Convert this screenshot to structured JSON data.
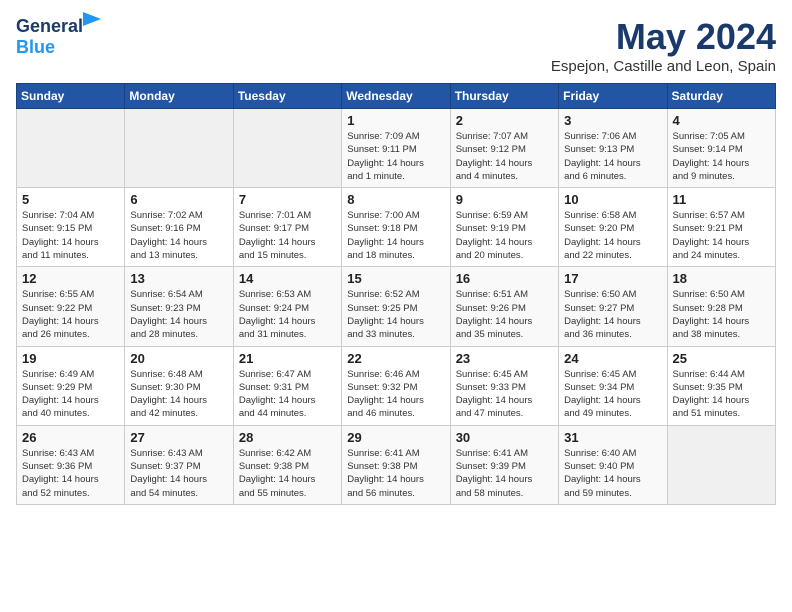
{
  "header": {
    "logo_line1": "General",
    "logo_line2": "Blue",
    "month": "May 2024",
    "location": "Espejon, Castille and Leon, Spain"
  },
  "weekdays": [
    "Sunday",
    "Monday",
    "Tuesday",
    "Wednesday",
    "Thursday",
    "Friday",
    "Saturday"
  ],
  "weeks": [
    [
      {
        "day": "",
        "info": ""
      },
      {
        "day": "",
        "info": ""
      },
      {
        "day": "",
        "info": ""
      },
      {
        "day": "1",
        "info": "Sunrise: 7:09 AM\nSunset: 9:11 PM\nDaylight: 14 hours\nand 1 minute."
      },
      {
        "day": "2",
        "info": "Sunrise: 7:07 AM\nSunset: 9:12 PM\nDaylight: 14 hours\nand 4 minutes."
      },
      {
        "day": "3",
        "info": "Sunrise: 7:06 AM\nSunset: 9:13 PM\nDaylight: 14 hours\nand 6 minutes."
      },
      {
        "day": "4",
        "info": "Sunrise: 7:05 AM\nSunset: 9:14 PM\nDaylight: 14 hours\nand 9 minutes."
      }
    ],
    [
      {
        "day": "5",
        "info": "Sunrise: 7:04 AM\nSunset: 9:15 PM\nDaylight: 14 hours\nand 11 minutes."
      },
      {
        "day": "6",
        "info": "Sunrise: 7:02 AM\nSunset: 9:16 PM\nDaylight: 14 hours\nand 13 minutes."
      },
      {
        "day": "7",
        "info": "Sunrise: 7:01 AM\nSunset: 9:17 PM\nDaylight: 14 hours\nand 15 minutes."
      },
      {
        "day": "8",
        "info": "Sunrise: 7:00 AM\nSunset: 9:18 PM\nDaylight: 14 hours\nand 18 minutes."
      },
      {
        "day": "9",
        "info": "Sunrise: 6:59 AM\nSunset: 9:19 PM\nDaylight: 14 hours\nand 20 minutes."
      },
      {
        "day": "10",
        "info": "Sunrise: 6:58 AM\nSunset: 9:20 PM\nDaylight: 14 hours\nand 22 minutes."
      },
      {
        "day": "11",
        "info": "Sunrise: 6:57 AM\nSunset: 9:21 PM\nDaylight: 14 hours\nand 24 minutes."
      }
    ],
    [
      {
        "day": "12",
        "info": "Sunrise: 6:55 AM\nSunset: 9:22 PM\nDaylight: 14 hours\nand 26 minutes."
      },
      {
        "day": "13",
        "info": "Sunrise: 6:54 AM\nSunset: 9:23 PM\nDaylight: 14 hours\nand 28 minutes."
      },
      {
        "day": "14",
        "info": "Sunrise: 6:53 AM\nSunset: 9:24 PM\nDaylight: 14 hours\nand 31 minutes."
      },
      {
        "day": "15",
        "info": "Sunrise: 6:52 AM\nSunset: 9:25 PM\nDaylight: 14 hours\nand 33 minutes."
      },
      {
        "day": "16",
        "info": "Sunrise: 6:51 AM\nSunset: 9:26 PM\nDaylight: 14 hours\nand 35 minutes."
      },
      {
        "day": "17",
        "info": "Sunrise: 6:50 AM\nSunset: 9:27 PM\nDaylight: 14 hours\nand 36 minutes."
      },
      {
        "day": "18",
        "info": "Sunrise: 6:50 AM\nSunset: 9:28 PM\nDaylight: 14 hours\nand 38 minutes."
      }
    ],
    [
      {
        "day": "19",
        "info": "Sunrise: 6:49 AM\nSunset: 9:29 PM\nDaylight: 14 hours\nand 40 minutes."
      },
      {
        "day": "20",
        "info": "Sunrise: 6:48 AM\nSunset: 9:30 PM\nDaylight: 14 hours\nand 42 minutes."
      },
      {
        "day": "21",
        "info": "Sunrise: 6:47 AM\nSunset: 9:31 PM\nDaylight: 14 hours\nand 44 minutes."
      },
      {
        "day": "22",
        "info": "Sunrise: 6:46 AM\nSunset: 9:32 PM\nDaylight: 14 hours\nand 46 minutes."
      },
      {
        "day": "23",
        "info": "Sunrise: 6:45 AM\nSunset: 9:33 PM\nDaylight: 14 hours\nand 47 minutes."
      },
      {
        "day": "24",
        "info": "Sunrise: 6:45 AM\nSunset: 9:34 PM\nDaylight: 14 hours\nand 49 minutes."
      },
      {
        "day": "25",
        "info": "Sunrise: 6:44 AM\nSunset: 9:35 PM\nDaylight: 14 hours\nand 51 minutes."
      }
    ],
    [
      {
        "day": "26",
        "info": "Sunrise: 6:43 AM\nSunset: 9:36 PM\nDaylight: 14 hours\nand 52 minutes."
      },
      {
        "day": "27",
        "info": "Sunrise: 6:43 AM\nSunset: 9:37 PM\nDaylight: 14 hours\nand 54 minutes."
      },
      {
        "day": "28",
        "info": "Sunrise: 6:42 AM\nSunset: 9:38 PM\nDaylight: 14 hours\nand 55 minutes."
      },
      {
        "day": "29",
        "info": "Sunrise: 6:41 AM\nSunset: 9:38 PM\nDaylight: 14 hours\nand 56 minutes."
      },
      {
        "day": "30",
        "info": "Sunrise: 6:41 AM\nSunset: 9:39 PM\nDaylight: 14 hours\nand 58 minutes."
      },
      {
        "day": "31",
        "info": "Sunrise: 6:40 AM\nSunset: 9:40 PM\nDaylight: 14 hours\nand 59 minutes."
      },
      {
        "day": "",
        "info": ""
      }
    ]
  ]
}
